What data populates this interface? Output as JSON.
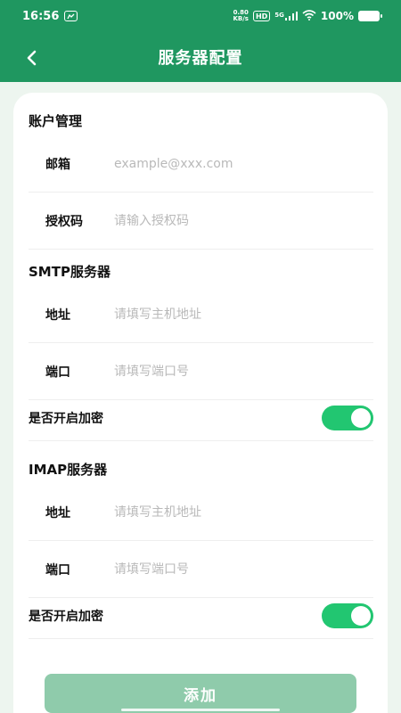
{
  "status_bar": {
    "time": "16:56",
    "netspeed_value": "0.80",
    "netspeed_unit": "KB/s",
    "hd_badge": "HD",
    "signal_label": "5G",
    "battery_percent": "100%"
  },
  "header": {
    "title": "服务器配置"
  },
  "account": {
    "section_title": "账户管理",
    "email_label": "邮箱",
    "email_placeholder": "example@xxx.com",
    "auth_label": "授权码",
    "auth_placeholder": "请输入授权码"
  },
  "smtp": {
    "section_title": "SMTP服务器",
    "address_label": "地址",
    "address_placeholder": "请填写主机地址",
    "port_label": "端口",
    "port_placeholder": "请填写端口号",
    "encrypt_label": "是否开启加密",
    "encrypt_on": true
  },
  "imap": {
    "section_title": "IMAP服务器",
    "address_label": "地址",
    "address_placeholder": "请填写主机地址",
    "port_label": "端口",
    "port_placeholder": "请填写端口号",
    "encrypt_label": "是否开启加密",
    "encrypt_on": true
  },
  "actions": {
    "add_label": "添加"
  },
  "colors": {
    "brand": "#1f9760",
    "toggle_on": "#22c671",
    "button_disabled": "#8fcbab"
  }
}
